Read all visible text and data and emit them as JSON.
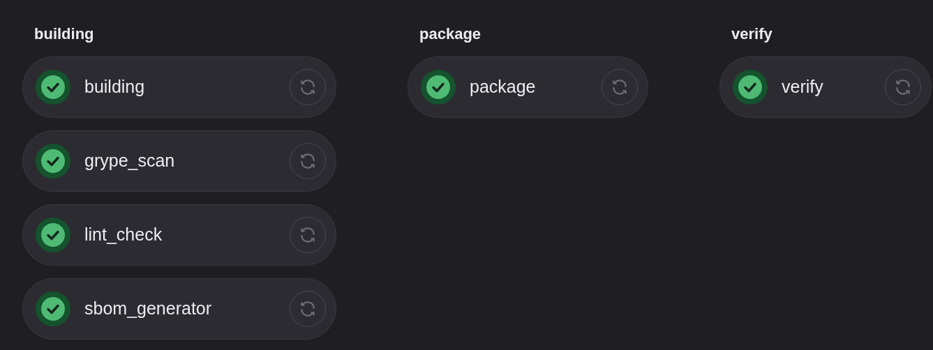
{
  "stages": [
    {
      "title": "building",
      "jobs": [
        {
          "name": "building",
          "passed": true
        },
        {
          "name": "grype_scan",
          "passed": true
        },
        {
          "name": "lint_check",
          "passed": true
        },
        {
          "name": "sbom_generator",
          "passed": true
        }
      ]
    },
    {
      "title": "package",
      "jobs": [
        {
          "name": "package",
          "passed": true
        }
      ]
    },
    {
      "title": "verify",
      "jobs": [
        {
          "name": "verify",
          "passed": true
        }
      ]
    }
  ]
}
